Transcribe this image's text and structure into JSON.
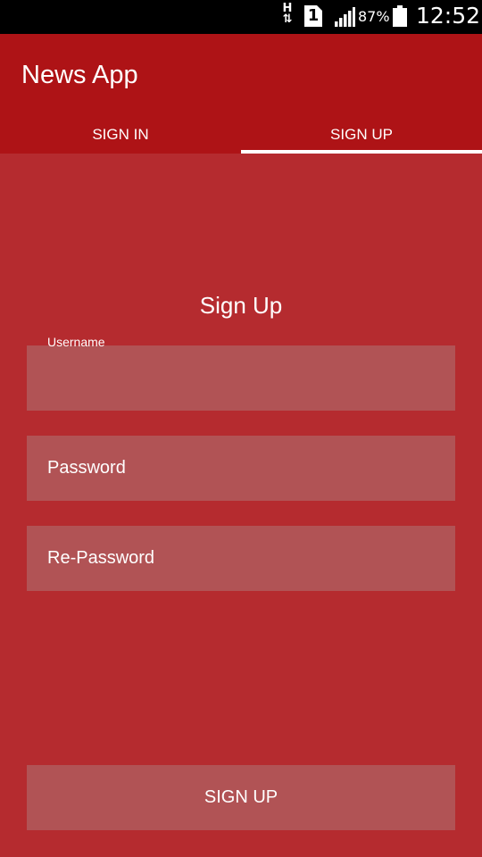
{
  "status_bar": {
    "network_type": "H",
    "sim_slot": "1",
    "battery_percent": "87%",
    "time": "12:52"
  },
  "app": {
    "title": "News App",
    "theme": {
      "primary": "#ae1316",
      "background": "#b52b2f",
      "field": "#b15355",
      "text": "#ffffff"
    }
  },
  "tabs": [
    {
      "label": "SIGN IN",
      "selected": false
    },
    {
      "label": "SIGN UP",
      "selected": true
    }
  ],
  "form": {
    "title": "Sign Up",
    "username": {
      "label": "Username",
      "value": ""
    },
    "password": {
      "placeholder": "Password"
    },
    "repassword": {
      "placeholder": "Re-Password"
    },
    "submit_label": "SIGN UP"
  },
  "icons": {
    "status_bar": [
      "network-h-icon",
      "sim-1-icon",
      "signal-icon",
      "battery-icon"
    ]
  }
}
